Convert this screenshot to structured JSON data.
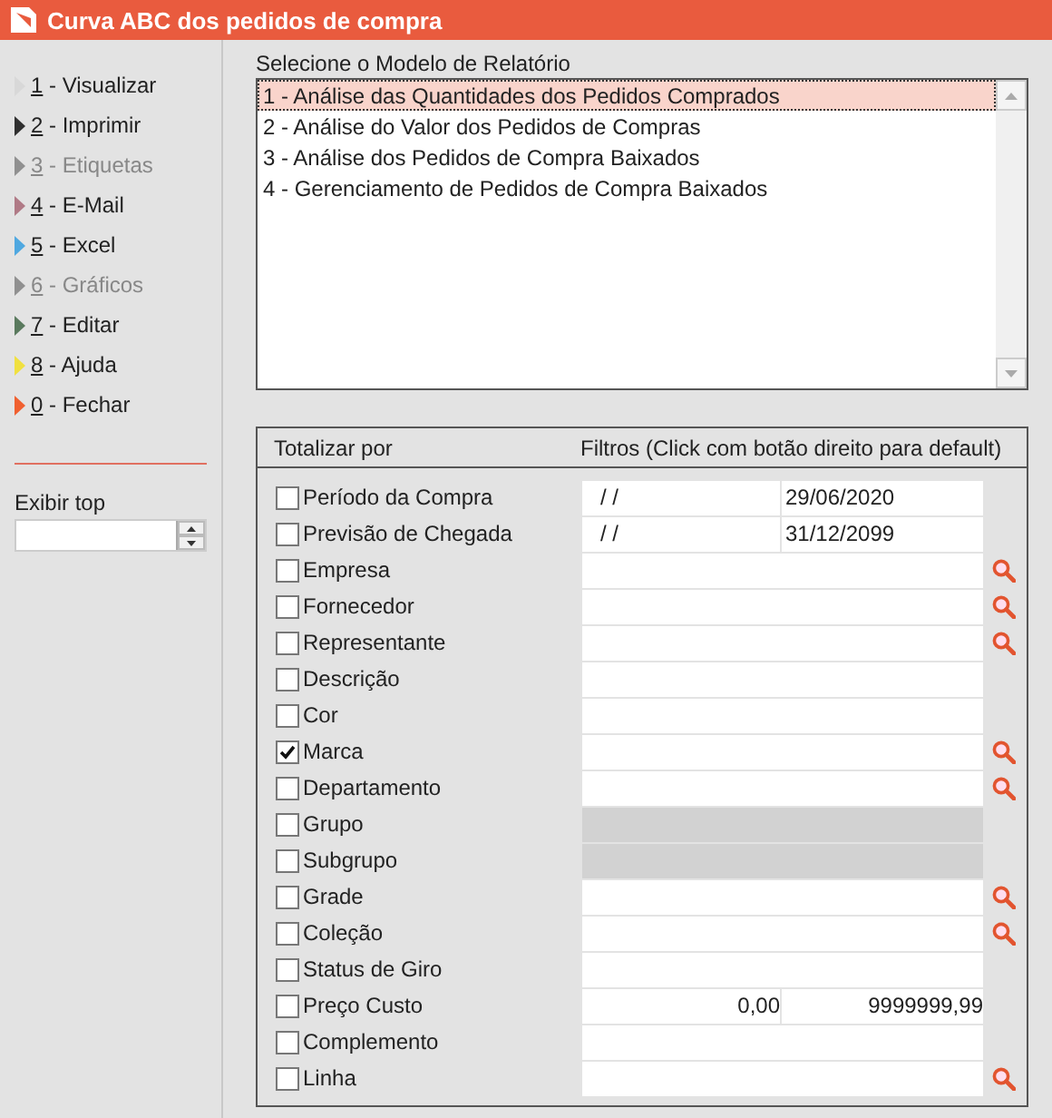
{
  "window": {
    "title": "Curva ABC dos pedidos de compra"
  },
  "menu": [
    {
      "key": "1",
      "label": " - Visualizar",
      "color": "#d8d8d8",
      "disabled": false
    },
    {
      "key": "2",
      "label": " - Imprimir",
      "color": "#303030",
      "disabled": false
    },
    {
      "key": "3",
      "label": " - Etiquetas",
      "color": "#909090",
      "disabled": true
    },
    {
      "key": "4",
      "label": " - E-Mail",
      "color": "#b07a86",
      "disabled": false
    },
    {
      "key": "5",
      "label": " - Excel",
      "color": "#4fa8e0",
      "disabled": false
    },
    {
      "key": "6",
      "label": " - Gráficos",
      "color": "#909090",
      "disabled": true
    },
    {
      "key": "7",
      "label": " - Editar",
      "color": "#5a7a5e",
      "disabled": false
    },
    {
      "key": "8",
      "label": " - Ajuda",
      "color": "#f0e040",
      "disabled": false
    },
    {
      "key": "0",
      "label": " - Fechar",
      "color": "#f06030",
      "disabled": false
    }
  ],
  "exibir_top": {
    "label": "Exibir top"
  },
  "report_models": {
    "label": "Selecione o Modelo de Relatório",
    "items": [
      {
        "text": "1 - Análise das Quantidades dos Pedidos Comprados",
        "selected": true
      },
      {
        "text": "2 - Análise do Valor dos Pedidos de Compras",
        "selected": false
      },
      {
        "text": "3 - Análise dos Pedidos de Compra Baixados",
        "selected": false
      },
      {
        "text": "4 - Gerenciamento de Pedidos de Compra Baixados",
        "selected": false
      }
    ]
  },
  "filters": {
    "column_1": "Totalizar por",
    "column_2": "Filtros (Click com botão direito para default)",
    "rows": [
      {
        "label": "Período da Compra",
        "checked": false,
        "kind": "date_range",
        "from": "/ /",
        "to": "29/06/2020",
        "search": false
      },
      {
        "label": "Previsão de Chegada",
        "checked": false,
        "kind": "date_range",
        "from": "/ /",
        "to": "31/12/2099",
        "search": false
      },
      {
        "label": "Empresa",
        "checked": false,
        "kind": "text",
        "search": true
      },
      {
        "label": "Fornecedor",
        "checked": false,
        "kind": "text",
        "search": true
      },
      {
        "label": "Representante",
        "checked": false,
        "kind": "text",
        "search": true
      },
      {
        "label": "Descrição",
        "checked": false,
        "kind": "text",
        "search": false
      },
      {
        "label": "Cor",
        "checked": false,
        "kind": "text",
        "search": false
      },
      {
        "label": "Marca",
        "checked": true,
        "kind": "text",
        "search": true
      },
      {
        "label": "Departamento",
        "checked": false,
        "kind": "text",
        "search": true
      },
      {
        "label": "Grupo",
        "checked": false,
        "kind": "disabled",
        "search": false
      },
      {
        "label": "Subgrupo",
        "checked": false,
        "kind": "disabled",
        "search": false
      },
      {
        "label": "Grade",
        "checked": false,
        "kind": "text",
        "search": true
      },
      {
        "label": "Coleção",
        "checked": false,
        "kind": "text",
        "search": true
      },
      {
        "label": "Status de Giro",
        "checked": false,
        "kind": "text",
        "search": false
      },
      {
        "label": "Preço Custo",
        "checked": false,
        "kind": "number_range",
        "from": "0,00",
        "to": "9999999,99",
        "search": false
      },
      {
        "label": "Complemento",
        "checked": false,
        "kind": "text",
        "search": false
      },
      {
        "label": "Linha",
        "checked": false,
        "kind": "text",
        "search": true
      }
    ]
  }
}
